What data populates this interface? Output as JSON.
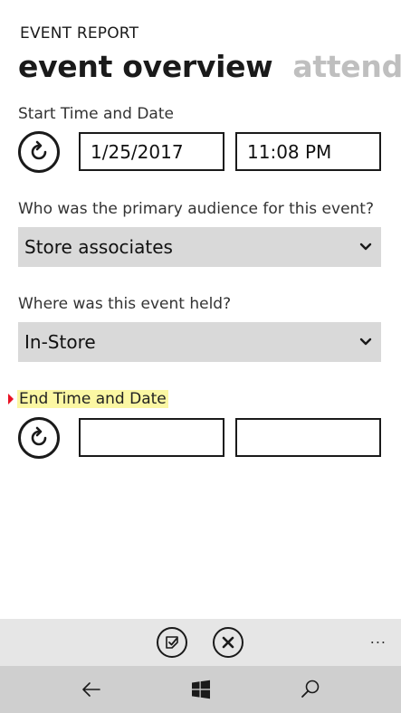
{
  "app": {
    "title": "EVENT REPORT"
  },
  "pivot": {
    "active_label": "event overview",
    "next_label": "attendees"
  },
  "start": {
    "label": "Start Time and Date",
    "date_value": "1/25/2017",
    "time_value": "11:08 PM"
  },
  "audience": {
    "question": "Who was the primary audience for this event?",
    "selected": "Store associates"
  },
  "location": {
    "question": "Where was this event held?",
    "selected": "In-Store"
  },
  "end": {
    "label": "End Time and Date",
    "date_value": "",
    "time_value": ""
  },
  "app_bar": {
    "more_label": "..."
  },
  "icons": {
    "reset": "refresh-icon",
    "dropdown": "chevron-down-icon",
    "save": "save-check-icon",
    "cancel": "close-icon",
    "back": "back-arrow-icon",
    "windows": "windows-logo-icon",
    "search": "search-icon"
  },
  "colors": {
    "highlight": "#fbf7a3",
    "error_marker": "#e81123",
    "dropdown_bg": "#d9d9d9",
    "app_bar_bg": "#e6e6e6",
    "nav_bar_bg": "#cfcfcf"
  }
}
